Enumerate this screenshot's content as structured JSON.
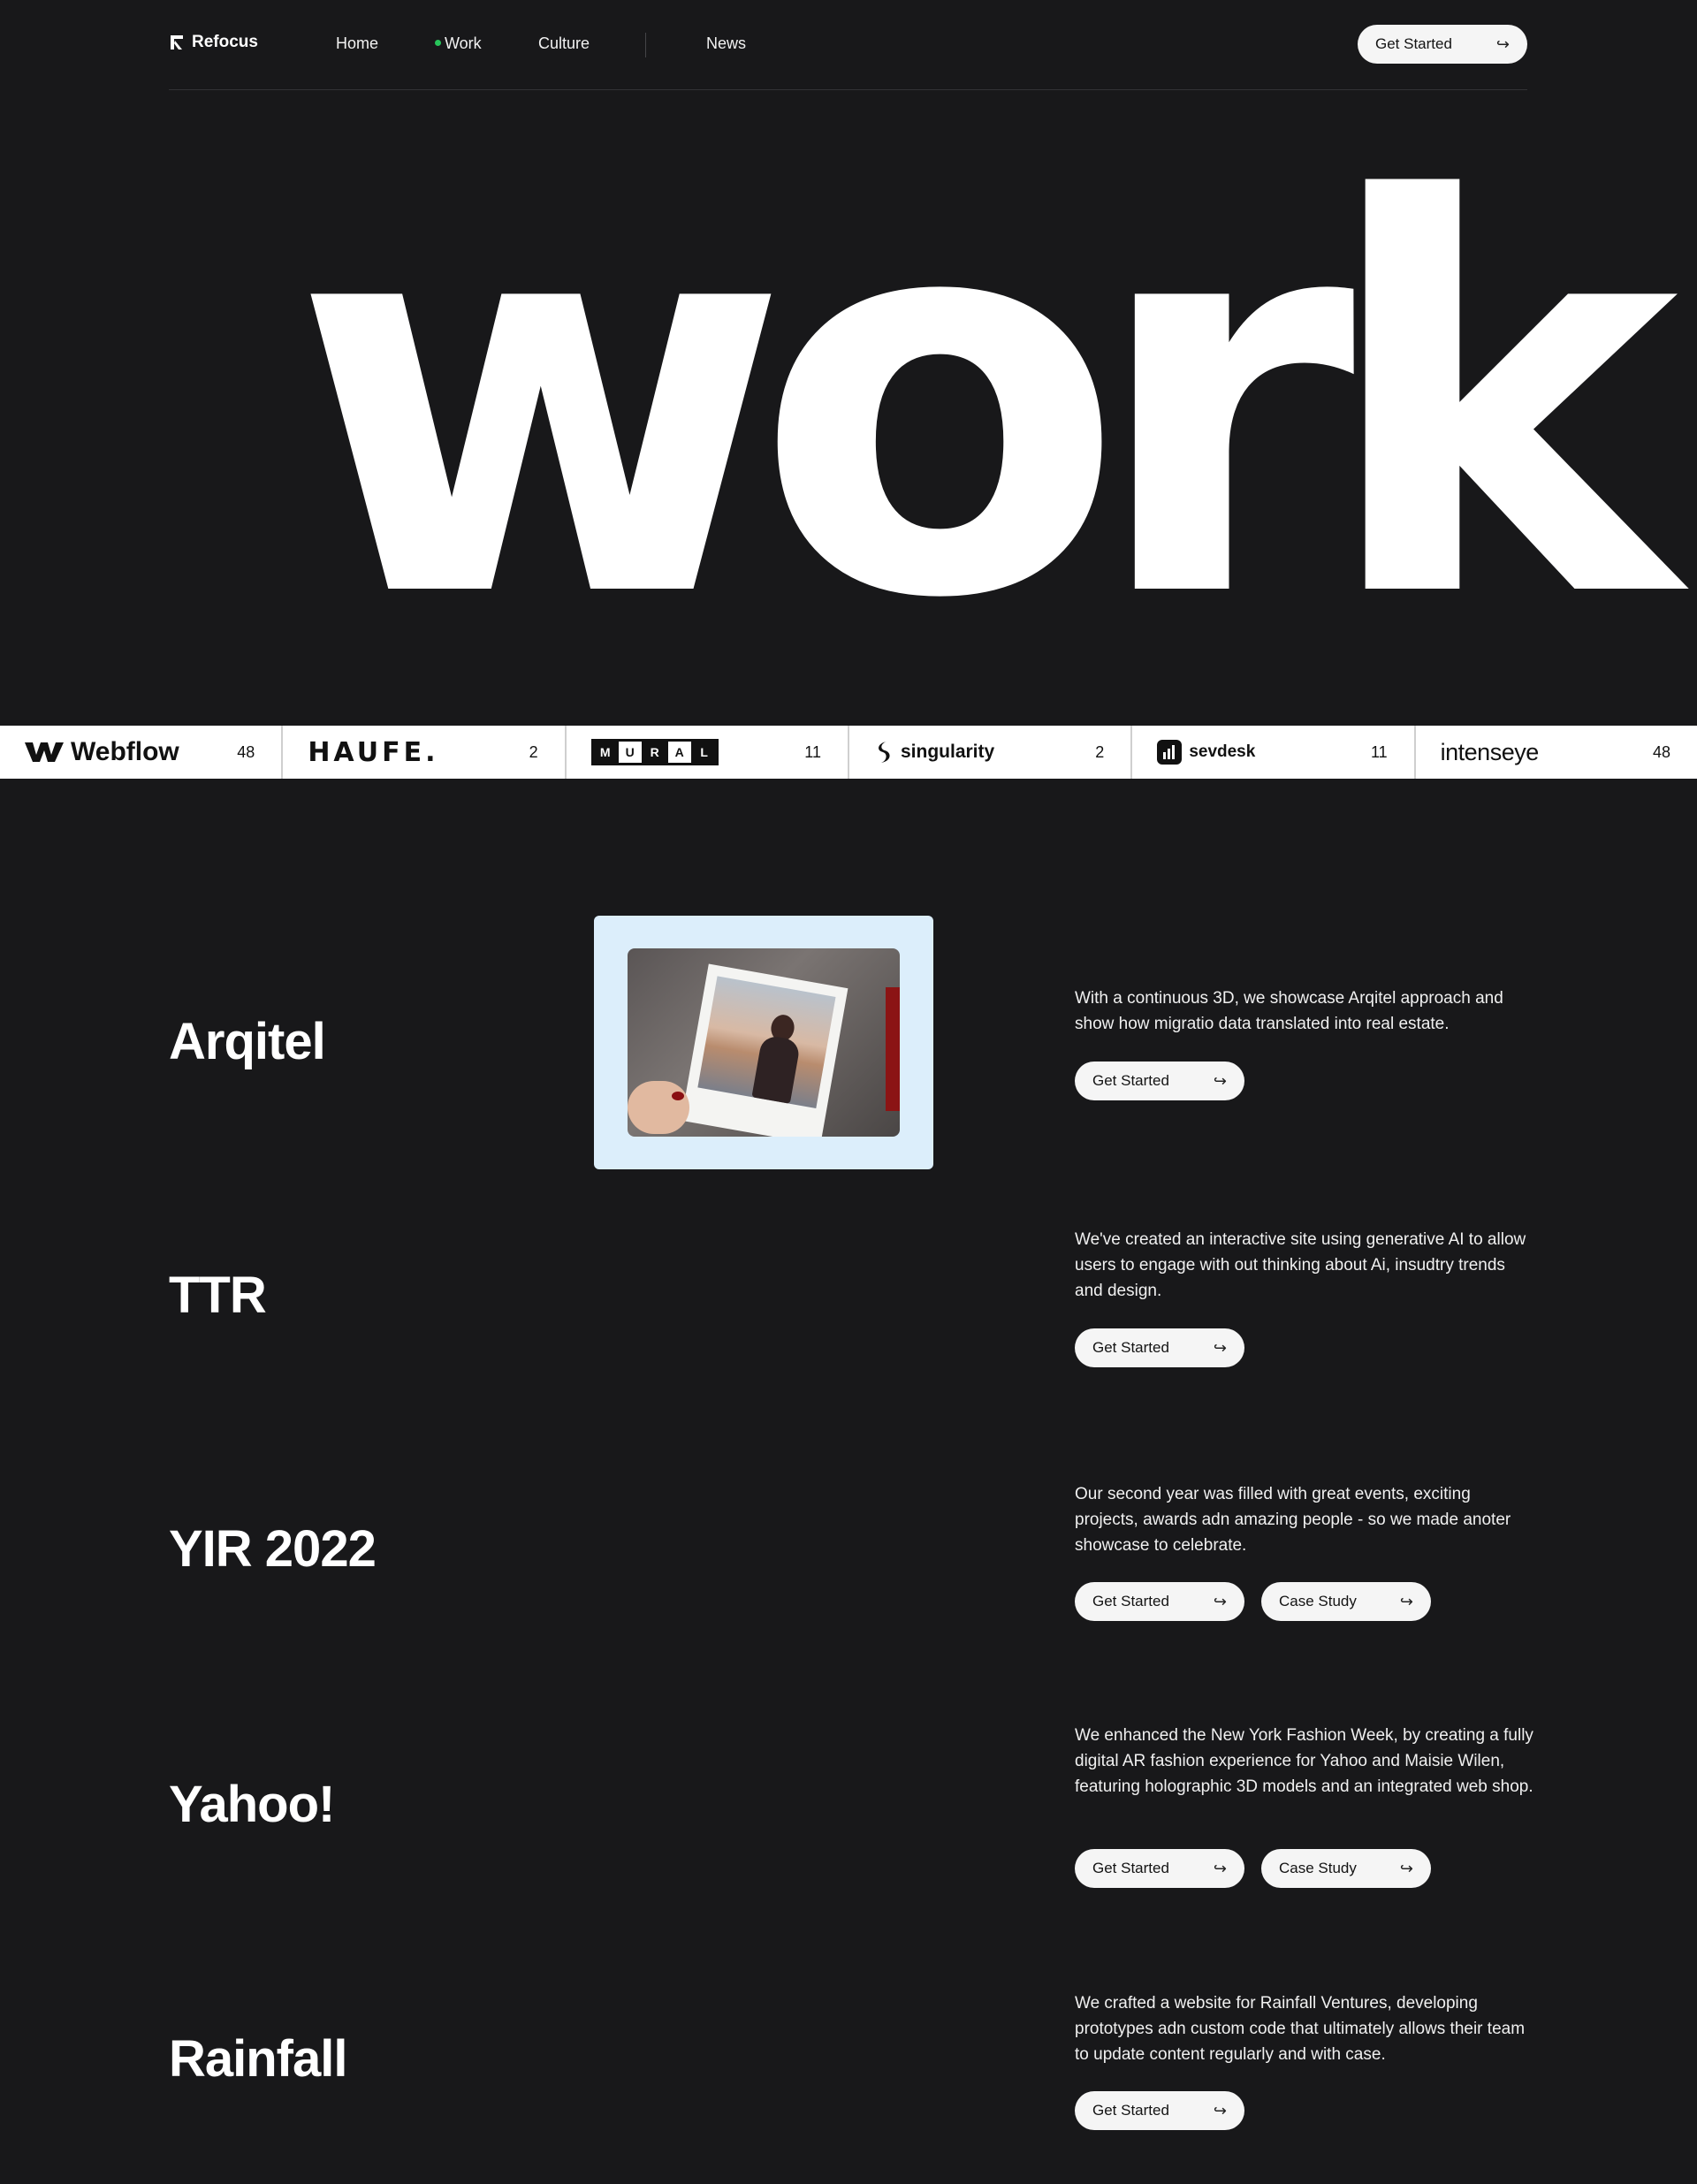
{
  "nav": {
    "brand": "Refocus",
    "links": [
      "Home",
      "Work",
      "Culture",
      "News"
    ],
    "active": "Work",
    "cta": "Get Started"
  },
  "hero": {
    "title": "work"
  },
  "clients": [
    {
      "name": "Webflow",
      "count": "48"
    },
    {
      "name": "HAUFE.",
      "count": "2"
    },
    {
      "name": "MURAL",
      "count": "11"
    },
    {
      "name": "singularity",
      "count": "2"
    },
    {
      "name": "sevdesk",
      "count": "11"
    },
    {
      "name": "intenseye",
      "count": "48"
    }
  ],
  "projects": [
    {
      "title": "Arqitel",
      "description": "With a continuous 3D, we showcase Arqitel approach and show how migratio data translated into real estate.",
      "primary_label": "Get Started"
    },
    {
      "title": "TTR",
      "description": "We've created an interactive site using generative AI to allow users to engage with out thinking about Ai, insudtry trends and design.",
      "primary_label": "Get Started"
    },
    {
      "title": "YIR 2022",
      "description": "Our second year was filled with great events, exciting projects, awards adn amazing people - so we made anoter showcase to celebrate.",
      "primary_label": "Get Started",
      "secondary_label": "Case Study"
    },
    {
      "title": "Yahoo!",
      "description": "We enhanced the New York Fashion Week, by creating a fully digital AR fashion experience for Yahoo and Maisie Wilen, featuring holographic 3D models and an integrated web shop.",
      "primary_label": "Get Started",
      "secondary_label": "Case Study"
    },
    {
      "title": "Rainfall",
      "description": "We crafted a website for Rainfall Ventures, developing prototypes adn custom code that ultimately allows their team to update content regularly and with case.",
      "primary_label": "Get Started"
    }
  ],
  "colors": {
    "background": "#18181a",
    "active_dot": "#27c45a",
    "button_bg": "#f5f5f5"
  },
  "icons": {
    "brand": "refocus-logo-icon",
    "button_arrow": "return-arrow-icon"
  }
}
